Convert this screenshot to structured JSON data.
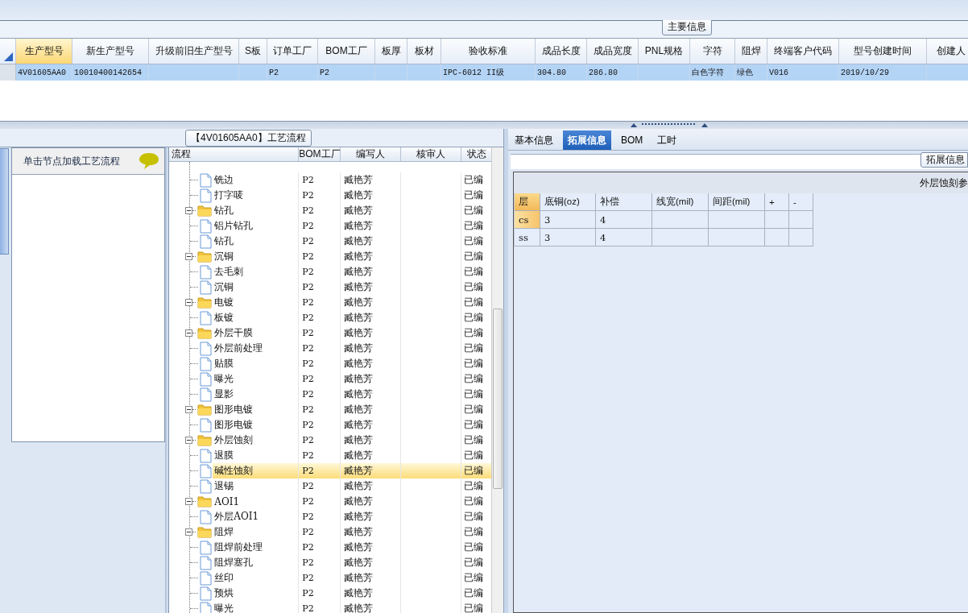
{
  "main_info": {
    "title": "主要信息",
    "columns": [
      {
        "label": "生产型号",
        "selected": true
      },
      {
        "label": "新生产型号",
        "selected": false
      },
      {
        "label": "升级前旧生产型号",
        "selected": false
      },
      {
        "label": "S板",
        "selected": false
      },
      {
        "label": "订单工厂",
        "selected": false
      },
      {
        "label": "BOM工厂",
        "selected": false
      },
      {
        "label": "板厚",
        "selected": false
      },
      {
        "label": "板材",
        "selected": false
      },
      {
        "label": "验收标准",
        "selected": false
      },
      {
        "label": "成品长度",
        "selected": false
      },
      {
        "label": "成品宽度",
        "selected": false
      },
      {
        "label": "PNL规格",
        "selected": false
      },
      {
        "label": "字符",
        "selected": false
      },
      {
        "label": "阻焊",
        "selected": false
      },
      {
        "label": "终端客户代码",
        "selected": false
      },
      {
        "label": "型号创建时间",
        "selected": false
      },
      {
        "label": "创建人",
        "selected": false
      }
    ],
    "rows": [
      {
        "selected": true,
        "cells": [
          "4V01605AA0",
          "10010400142654",
          null,
          null,
          "P2",
          "P2",
          null,
          null,
          "IPC-6012 II级",
          "304.80",
          "286.80",
          null,
          "白色字符",
          "绿色",
          "V016",
          "2019/10/29",
          null
        ]
      }
    ]
  },
  "left_panel": {
    "hint": "单击节点加载工艺流程"
  },
  "process": {
    "title": "【4V01605AA0】工艺流程",
    "columns": [
      "流程",
      "BOM工厂",
      "编写人",
      "核审人",
      "状态"
    ],
    "nodes": [
      {
        "kind": "continued",
        "children": [
          {
            "kind": "step",
            "label": "铣边",
            "bom": "P2",
            "writer": "臧艳芳",
            "status": "已编",
            "selected": false
          },
          {
            "kind": "step",
            "label": "打字唛",
            "bom": "P2",
            "writer": "臧艳芳",
            "status": "已编",
            "selected": false
          }
        ]
      },
      {
        "kind": "group",
        "label": "钻孔",
        "bom": "P2",
        "writer": "臧艳芳",
        "status": "已编",
        "selected": false,
        "expanded": true,
        "children": [
          {
            "kind": "step",
            "label": "铝片钻孔",
            "bom": "P2",
            "writer": "臧艳芳",
            "status": "已编",
            "selected": false
          },
          {
            "kind": "step",
            "label": "钻孔",
            "bom": "P2",
            "writer": "臧艳芳",
            "status": "已编",
            "selected": false
          }
        ]
      },
      {
        "kind": "group",
        "label": "沉铜",
        "bom": "P2",
        "writer": "臧艳芳",
        "status": "已编",
        "selected": false,
        "expanded": true,
        "children": [
          {
            "kind": "step",
            "label": "去毛刺",
            "bom": "P2",
            "writer": "臧艳芳",
            "status": "已编",
            "selected": false
          },
          {
            "kind": "step",
            "label": "沉铜",
            "bom": "P2",
            "writer": "臧艳芳",
            "status": "已编",
            "selected": false
          }
        ]
      },
      {
        "kind": "group",
        "label": "电镀",
        "bom": "P2",
        "writer": "臧艳芳",
        "status": "已编",
        "selected": false,
        "expanded": true,
        "children": [
          {
            "kind": "step",
            "label": "板镀",
            "bom": "P2",
            "writer": "臧艳芳",
            "status": "已编",
            "selected": false
          }
        ]
      },
      {
        "kind": "group",
        "label": "外层干膜",
        "bom": "P2",
        "writer": "臧艳芳",
        "status": "已编",
        "selected": false,
        "expanded": true,
        "children": [
          {
            "kind": "step",
            "label": "外层前处理",
            "bom": "P2",
            "writer": "臧艳芳",
            "status": "已编",
            "selected": false
          },
          {
            "kind": "step",
            "label": "贴膜",
            "bom": "P2",
            "writer": "臧艳芳",
            "status": "已编",
            "selected": false
          },
          {
            "kind": "step",
            "label": "曝光",
            "bom": "P2",
            "writer": "臧艳芳",
            "status": "已编",
            "selected": false
          },
          {
            "kind": "step",
            "label": "显影",
            "bom": "P2",
            "writer": "臧艳芳",
            "status": "已编",
            "selected": false
          }
        ]
      },
      {
        "kind": "group",
        "label": "图形电镀",
        "bom": "P2",
        "writer": "臧艳芳",
        "status": "已编",
        "selected": false,
        "expanded": true,
        "children": [
          {
            "kind": "step",
            "label": "图形电镀",
            "bom": "P2",
            "writer": "臧艳芳",
            "status": "已编",
            "selected": false
          }
        ]
      },
      {
        "kind": "group",
        "label": "外层蚀刻",
        "bom": "P2",
        "writer": "臧艳芳",
        "status": "已编",
        "selected": false,
        "expanded": true,
        "children": [
          {
            "kind": "step",
            "label": "退膜",
            "bom": "P2",
            "writer": "臧艳芳",
            "status": "已编",
            "selected": false
          },
          {
            "kind": "step",
            "label": "碱性蚀刻",
            "bom": "P2",
            "writer": "臧艳芳",
            "status": "已编",
            "selected": true
          },
          {
            "kind": "step",
            "label": "退锡",
            "bom": "P2",
            "writer": "臧艳芳",
            "status": "已编",
            "selected": false
          }
        ]
      },
      {
        "kind": "group",
        "label": "AOI1",
        "bom": "P2",
        "writer": "臧艳芳",
        "status": "已编",
        "selected": false,
        "expanded": true,
        "children": [
          {
            "kind": "step",
            "label": "外层AOI1",
            "bom": "P2",
            "writer": "臧艳芳",
            "status": "已编",
            "selected": false
          }
        ]
      },
      {
        "kind": "group",
        "label": "阻焊",
        "bom": "P2",
        "writer": "臧艳芳",
        "status": "已编",
        "selected": false,
        "expanded": true,
        "children": [
          {
            "kind": "step",
            "label": "阻焊前处理",
            "bom": "P2",
            "writer": "臧艳芳",
            "status": "已编",
            "selected": false
          },
          {
            "kind": "step",
            "label": "阻焊塞孔",
            "bom": "P2",
            "writer": "臧艳芳",
            "status": "已编",
            "selected": false
          },
          {
            "kind": "step",
            "label": "丝印",
            "bom": "P2",
            "writer": "臧艳芳",
            "status": "已编",
            "selected": false
          },
          {
            "kind": "step",
            "label": "预烘",
            "bom": "P2",
            "writer": "臧艳芳",
            "status": "已编",
            "selected": false
          },
          {
            "kind": "step",
            "label": "曝光",
            "bom": "P2",
            "writer": "臧艳芳",
            "status": "已编",
            "selected": false
          }
        ]
      }
    ]
  },
  "detail": {
    "tabs": [
      {
        "label": "基本信息",
        "selected": false
      },
      {
        "label": "拓展信息",
        "selected": true
      },
      {
        "label": "BOM",
        "selected": false
      },
      {
        "label": "工时",
        "selected": false
      }
    ],
    "group_title": "拓展信息",
    "section_title": "外层蚀刻参",
    "columns": [
      "层",
      "底铜(oz)",
      "补偿",
      "线宽(mil)",
      "间距(mil)",
      "+",
      "-"
    ],
    "rows": [
      {
        "selected": true,
        "cells": [
          "cs",
          "3",
          "4",
          null,
          null,
          null,
          null
        ]
      },
      {
        "selected": false,
        "cells": [
          "ss",
          "3",
          "4",
          null,
          null,
          null,
          null
        ]
      }
    ]
  }
}
